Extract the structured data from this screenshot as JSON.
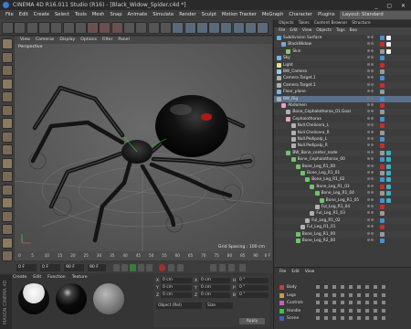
{
  "window": {
    "title": "CINEMA 4D R16.011 Studio (R16) - [Black_Widow_Spider.c4d *]",
    "controls": "_ ▢ ✕"
  },
  "menubar": {
    "items": [
      "File",
      "Edit",
      "Create",
      "Select",
      "Tools",
      "Mesh",
      "Snap",
      "Animate",
      "Simulate",
      "Render",
      "Sculpt",
      "Motion Tracker",
      "MoGraph",
      "Character",
      "Plugins",
      "Script",
      "Window",
      "Help"
    ],
    "layout_label": "Layout:",
    "layout_value": "Standard"
  },
  "viewport": {
    "menu": [
      "View",
      "Cameras",
      "Display",
      "Options",
      "Filter",
      "Panel"
    ],
    "label": "Perspective",
    "grid_spacing": "Grid Spacing : 100 cm"
  },
  "timeline": {
    "ticks": [
      "0",
      "5",
      "10",
      "15",
      "20",
      "25",
      "30",
      "35",
      "40",
      "45",
      "50",
      "55",
      "60",
      "65",
      "70",
      "75",
      "80",
      "85",
      "90"
    ],
    "end": "0 F"
  },
  "transport": {
    "start_field": "0 F",
    "current_field": "0 F",
    "end_field": "90 F",
    "end_field2": "90 F"
  },
  "materials": {
    "menu": [
      "Create",
      "Edit",
      "Function",
      "Texture"
    ],
    "brand": "MAXON CINEMA 4D"
  },
  "coords": {
    "rows": [
      [
        "X",
        "0 cm",
        "X",
        "0 cm",
        "H",
        "0 °"
      ],
      [
        "Y",
        "0 cm",
        "Y",
        "0 cm",
        "P",
        "0 °"
      ],
      [
        "Z",
        "0 cm",
        "Z",
        "0 cm",
        "B",
        "0 °"
      ]
    ],
    "mode1": "Object (Rel)",
    "mode2": "Size",
    "apply": "Apply"
  },
  "object_manager": {
    "tabs": [
      "Objects",
      "Takes",
      "Content Browser",
      "Structure"
    ],
    "menu": [
      "File",
      "Edit",
      "View",
      "Objects",
      "Tags",
      "Boo"
    ],
    "rows": [
      {
        "name": "Subdivision Surface",
        "indent": 0,
        "icon": "#5fb0e8"
      },
      {
        "name": "BlackWidow",
        "indent": 1,
        "icon": "#7aa7d8"
      },
      {
        "name": "Skin",
        "indent": 2,
        "icon": "#8dc46a"
      },
      {
        "name": "Sky",
        "indent": 0,
        "icon": "#7ab4e6"
      },
      {
        "name": "Light",
        "indent": 0,
        "icon": "#e8e09a"
      },
      {
        "name": "BW_Camera",
        "indent": 0,
        "icon": "#8fd0e6"
      },
      {
        "name": "Camera.Target.1",
        "indent": 0,
        "icon": "#b0b0b0"
      },
      {
        "name": "Camera.Target.1",
        "indent": 0,
        "icon": "#b0b0b0"
      },
      {
        "name": "Floor_plane",
        "indent": 0,
        "icon": "#7ab4e6"
      },
      {
        "name": "BW_Rig",
        "indent": 0,
        "icon": "#b0b0b0"
      },
      {
        "name": "Abdomen",
        "indent": 1,
        "icon": "#e8a0c8"
      },
      {
        "name": "Bone_Cephalothorax_01.Goal",
        "indent": 2,
        "icon": "#b0b0b0"
      },
      {
        "name": "Cephalothorax",
        "indent": 2,
        "icon": "#e8a0c8"
      },
      {
        "name": "Null.Chelicera_L",
        "indent": 3,
        "icon": "#b0b0b0"
      },
      {
        "name": "Null.Chelicera_R",
        "indent": 3,
        "icon": "#b0b0b0"
      },
      {
        "name": "Null.Pedipalp_L",
        "indent": 3,
        "icon": "#b0b0b0"
      },
      {
        "name": "Null.Pedipalp_R",
        "indent": 3,
        "icon": "#b0b0b0"
      },
      {
        "name": "BW_Bone_center_node",
        "indent": 2,
        "icon": "#6fc46a"
      },
      {
        "name": "Bone_Cephalothorax_00",
        "indent": 3,
        "icon": "#6fc46a"
      },
      {
        "name": "Bone_Leg_R1_00",
        "indent": 4,
        "icon": "#6fc46a"
      },
      {
        "name": "Bone_Leg_R1_01",
        "indent": 5,
        "icon": "#6fc46a"
      },
      {
        "name": "Bone_Leg_R1_02",
        "indent": 6,
        "icon": "#6fc46a"
      },
      {
        "name": "Bone_Leg_R1_03",
        "indent": 7,
        "icon": "#6fc46a"
      },
      {
        "name": "Bone_Leg_R1_04",
        "indent": 8,
        "icon": "#6fc46a"
      },
      {
        "name": "Bone_Leg_R1_05",
        "indent": 9,
        "icon": "#6fc46a"
      },
      {
        "name": "Ful_Leg_R1_04",
        "indent": 8,
        "icon": "#b0b0b0"
      },
      {
        "name": "Ful_Leg_R1_03",
        "indent": 7,
        "icon": "#b0b0b0"
      },
      {
        "name": "Ful_Leg_R1_02",
        "indent": 6,
        "icon": "#b0b0b0"
      },
      {
        "name": "Ful_Leg_R1_01",
        "indent": 5,
        "icon": "#b0b0b0"
      },
      {
        "name": "Bone_Leg_R1_00",
        "indent": 4,
        "icon": "#6fc46a"
      },
      {
        "name": "Bone_Leg_R2_00",
        "indent": 4,
        "icon": "#6fc46a"
      }
    ]
  },
  "layer_manager": {
    "menu": [
      "File",
      "Edit",
      "View"
    ],
    "layers": [
      {
        "name": "Body",
        "color": "#c04040"
      },
      {
        "name": "Legs",
        "color": "#c0a040"
      },
      {
        "name": "Controls",
        "color": "#c060c0"
      },
      {
        "name": "Handle",
        "color": "#40c040"
      },
      {
        "name": "Scene",
        "color": "#4060c0"
      }
    ]
  }
}
